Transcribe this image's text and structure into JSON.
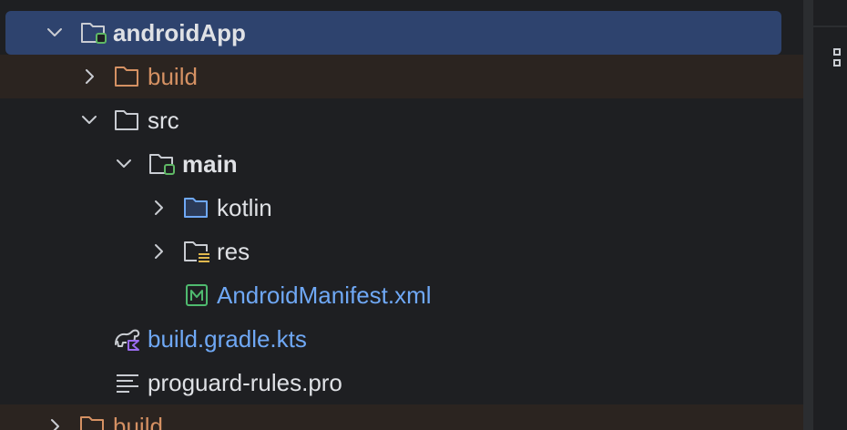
{
  "project_tree": {
    "items": [
      {
        "label": "androidApp",
        "icon": "module-folder-icon",
        "expanded": true,
        "selected": true
      },
      {
        "label": "build",
        "icon": "excluded-folder-icon",
        "expanded": false,
        "excluded": true
      },
      {
        "label": "src",
        "icon": "folder-icon",
        "expanded": true
      },
      {
        "label": "main",
        "icon": "module-folder-icon",
        "expanded": true
      },
      {
        "label": "kotlin",
        "icon": "source-folder-icon",
        "expanded": false
      },
      {
        "label": "res",
        "icon": "resources-folder-icon",
        "expanded": false
      },
      {
        "label": "AndroidManifest.xml",
        "icon": "manifest-file-icon"
      },
      {
        "label": "build.gradle.kts",
        "icon": "gradle-kotlin-file-icon"
      },
      {
        "label": "proguard-rules.pro",
        "icon": "text-file-icon"
      },
      {
        "label": "build",
        "icon": "excluded-folder-icon",
        "expanded": false,
        "excluded": true
      }
    ]
  },
  "colors": {
    "background": "#1e1f22",
    "selection": "#2e436e",
    "excluded_row": "#2b2420",
    "excluded_text": "#d59163",
    "link_text": "#6fa8f5",
    "default_text": "#dfe1e5",
    "module_badge": "#5fb865",
    "resources_badge": "#e0b84e",
    "manifest_green": "#4fba6f",
    "gradle_purple": "#9a6cf0"
  }
}
